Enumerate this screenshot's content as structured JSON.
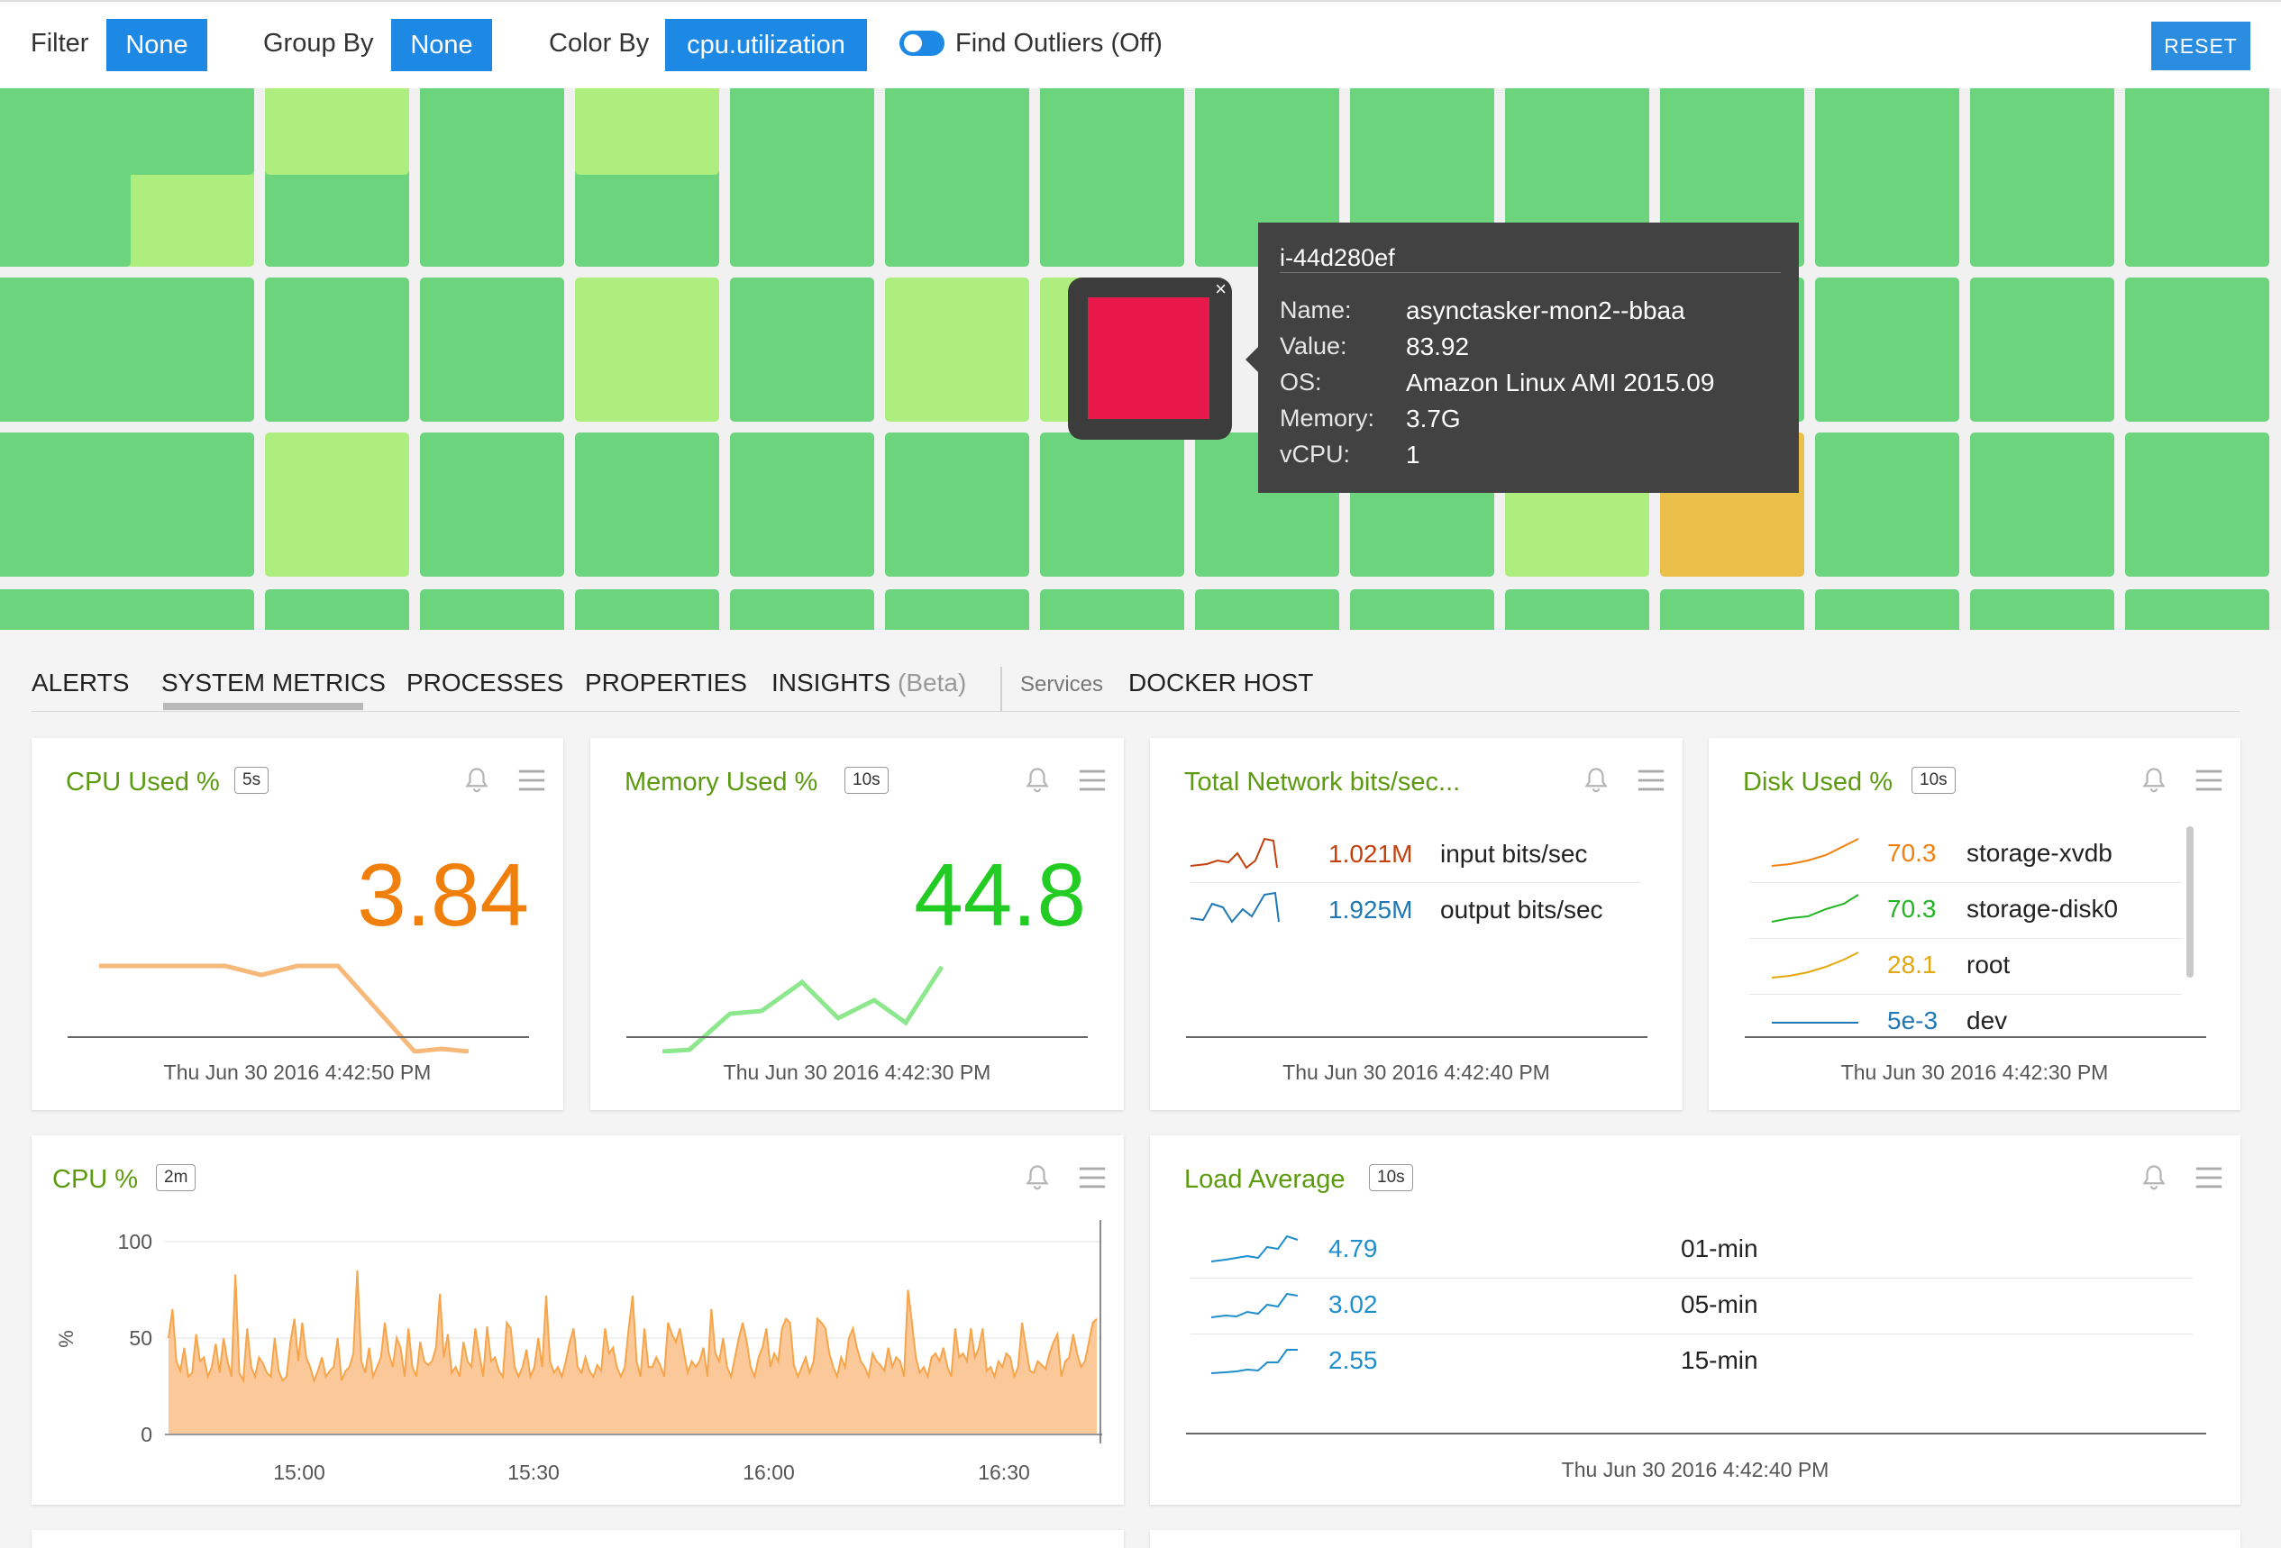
{
  "toolbar": {
    "filter_label": "Filter",
    "filter_value": "None",
    "group_label": "Group By",
    "group_value": "None",
    "color_label": "Color By",
    "color_value": "cpu.utilization",
    "outliers_label": "Find Outliers (Off)",
    "reset_label": "RESET"
  },
  "heatmap": {
    "colors": {
      "green": "#6dd47e",
      "lightgreen": "#aeee7e",
      "yellow": "#ebc04a",
      "red": "#e8184a"
    },
    "close_glyph": "×",
    "tooltip": {
      "id": "i-44d280ef",
      "rows": [
        {
          "key": "Name:",
          "value": "asynctasker-mon2--bbaa"
        },
        {
          "key": "Value:",
          "value": "83.92"
        },
        {
          "key": "OS:",
          "value": "Amazon Linux AMI 2015.09"
        },
        {
          "key": "Memory:",
          "value": "3.7G"
        },
        {
          "key": "vCPU:",
          "value": "1"
        }
      ]
    }
  },
  "tabs": {
    "alerts": "ALERTS",
    "system_metrics": "SYSTEM METRICS",
    "processes": "PROCESSES",
    "properties": "PROPERTIES",
    "insights": "INSIGHTS",
    "insights_beta": "(Beta)",
    "services": "Services",
    "docker_host": "DOCKER HOST"
  },
  "panels": {
    "cpu_used": {
      "title": "CPU Used %",
      "badge": "5s",
      "value": "3.84",
      "value_color": "#f07f0c",
      "timestamp": "Thu Jun 30 2016 4:42:50 PM"
    },
    "memory_used": {
      "title": "Memory Used %",
      "badge": "10s",
      "value": "44.8",
      "value_color": "#22cc22",
      "timestamp": "Thu Jun 30 2016 4:42:30 PM"
    },
    "network": {
      "title": "Total Network bits/sec...",
      "rows": [
        {
          "value": "1.021M",
          "name": "input bits/sec",
          "color": "#c2410c"
        },
        {
          "value": "1.925M",
          "name": "output bits/sec",
          "color": "#1f78b4"
        }
      ],
      "timestamp": "Thu Jun 30 2016 4:42:40 PM"
    },
    "disk_used": {
      "title": "Disk Used %",
      "badge": "10s",
      "rows": [
        {
          "value": "70.3",
          "name": "storage-xvdb",
          "color": "#f07f0c"
        },
        {
          "value": "70.3",
          "name": "storage-disk0",
          "color": "#22b422"
        },
        {
          "value": "28.1",
          "name": "root",
          "color": "#e2a80c"
        },
        {
          "value": "5e-3",
          "name": "dev",
          "color": "#1f78b4"
        }
      ],
      "timestamp": "Thu Jun 30 2016 4:42:30 PM"
    },
    "cpu_chart": {
      "title": "CPU %",
      "badge": "2m"
    },
    "load_average": {
      "title": "Load Average",
      "badge": "10s",
      "rows": [
        {
          "value": "4.79",
          "name": "01-min"
        },
        {
          "value": "3.02",
          "name": "05-min"
        },
        {
          "value": "2.55",
          "name": "15-min"
        }
      ],
      "value_color": "#1f8ecd",
      "timestamp": "Thu Jun 30 2016 4:42:40 PM"
    }
  },
  "chart_data": {
    "type": "area",
    "title": "",
    "xlabel": "",
    "ylabel": "%",
    "yticks": [
      "0",
      "50",
      "100"
    ],
    "xticks": [
      "15:00",
      "15:30",
      "16:00",
      "16:30"
    ],
    "ylim": [
      0,
      100
    ],
    "color": "#f7a54a",
    "fill": "#fbc89a",
    "values": [
      50,
      65,
      38,
      33,
      45,
      30,
      32,
      52,
      38,
      40,
      30,
      35,
      47,
      32,
      50,
      38,
      30,
      83,
      32,
      28,
      55,
      35,
      30,
      40,
      37,
      32,
      30,
      50,
      33,
      28,
      30,
      48,
      60,
      38,
      58,
      40,
      35,
      28,
      33,
      40,
      30,
      33,
      35,
      50,
      28,
      33,
      35,
      42,
      85,
      38,
      32,
      45,
      30,
      35,
      40,
      58,
      42,
      35,
      50,
      45,
      30,
      55,
      35,
      30,
      48,
      38,
      36,
      38,
      45,
      73,
      40,
      52,
      32,
      35,
      30,
      48,
      38,
      35,
      55,
      42,
      30,
      56,
      38,
      40,
      33,
      30,
      58,
      55,
      35,
      30,
      35,
      44,
      30,
      35,
      50,
      35,
      72,
      38,
      32,
      35,
      30,
      38,
      48,
      55,
      35,
      32,
      40,
      33,
      30,
      36,
      33,
      55,
      42,
      45,
      35,
      30,
      35,
      55,
      72,
      38,
      30,
      55,
      35,
      35,
      40,
      36,
      30,
      58,
      52,
      48,
      55,
      43,
      32,
      38,
      35,
      38,
      45,
      30,
      65,
      42,
      38,
      50,
      35,
      30,
      40,
      50,
      58,
      48,
      35,
      30,
      40,
      45,
      55,
      35,
      42,
      38,
      55,
      60,
      58,
      36,
      30,
      35,
      40,
      32,
      38,
      60,
      58,
      55,
      42,
      35,
      30,
      40,
      35,
      50,
      55,
      45,
      38,
      35,
      30,
      42,
      38,
      36,
      33,
      45,
      35,
      40,
      38,
      30,
      75,
      58,
      40,
      32,
      35,
      30,
      40,
      42,
      38,
      45,
      35,
      30,
      55,
      40,
      42,
      38,
      55,
      40,
      45,
      55,
      33,
      35,
      30,
      38,
      35,
      42,
      40,
      30,
      35,
      58,
      45,
      33,
      32,
      38,
      36,
      34,
      42,
      48,
      52,
      30,
      38,
      40,
      52,
      42,
      35,
      38,
      48,
      58,
      60
    ]
  }
}
